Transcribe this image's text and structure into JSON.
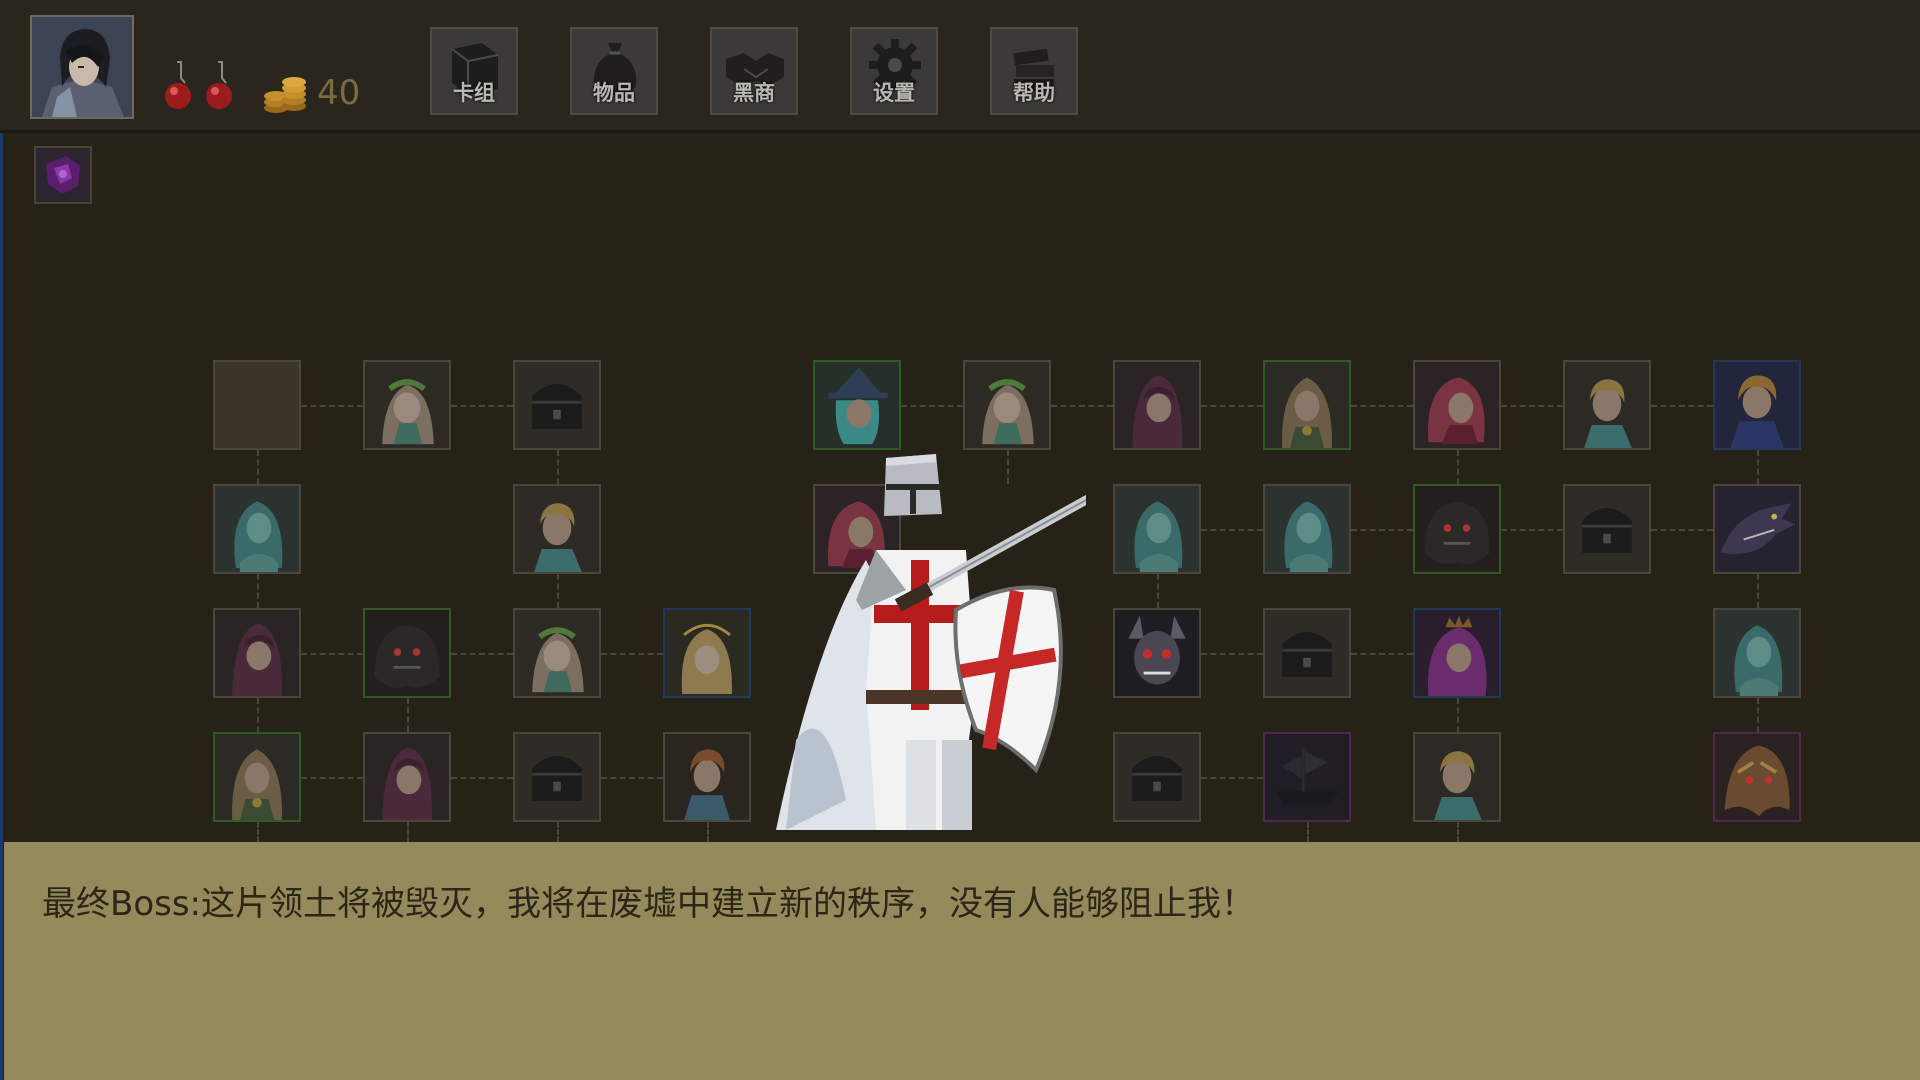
{
  "hud": {
    "avatar_icon": "player-portrait-icon",
    "potions": [
      "red-potion-icon",
      "red-potion-icon"
    ],
    "gold_icon": "gold-coins-icon",
    "gold": "40"
  },
  "menu": [
    {
      "label": "卡组",
      "icon": "book-icon"
    },
    {
      "label": "物品",
      "icon": "bag-icon"
    },
    {
      "label": "黑商",
      "icon": "handshake-icon"
    },
    {
      "label": "设置",
      "icon": "gear-icon"
    },
    {
      "label": "帮助",
      "icon": "books-icon"
    }
  ],
  "relic_icon": "purple-relic-icon",
  "map_nodes": [
    {
      "name": "node-empty",
      "icon": "empty-node",
      "border": "normal"
    },
    {
      "name": "node-elf-girl",
      "icon": "elf-girl-icon",
      "border": "normal"
    },
    {
      "name": "node-chest",
      "icon": "chest-icon",
      "border": "normal"
    },
    {
      "name": "node-witch",
      "icon": "witch-icon",
      "border": "green"
    },
    {
      "name": "node-elf-girl",
      "icon": "elf-girl-icon",
      "border": "normal"
    },
    {
      "name": "node-hooded-figure",
      "icon": "hooded-figure-icon",
      "border": "normal"
    },
    {
      "name": "node-priestess",
      "icon": "priestess-icon",
      "border": "green"
    },
    {
      "name": "node-pink-hair-girl",
      "icon": "pink-hair-girl-icon",
      "border": "normal"
    },
    {
      "name": "node-blond-boy",
      "icon": "blond-boy-icon",
      "border": "normal"
    },
    {
      "name": "node-hero-boy",
      "icon": "hero-boy-icon",
      "border": "blue"
    },
    {
      "name": "node-ghost-maiden",
      "icon": "ghost-maiden-icon",
      "border": "normal"
    },
    {
      "name": "node-blond-boy",
      "icon": "blond-boy-icon",
      "border": "normal"
    },
    {
      "name": "node-pink-hair-girl",
      "icon": "pink-hair-girl-icon",
      "border": "normal"
    },
    {
      "name": "node-ghost-maiden",
      "icon": "ghost-maiden-icon",
      "border": "normal"
    },
    {
      "name": "node-ghost-maiden",
      "icon": "ghost-maiden-icon",
      "border": "normal"
    },
    {
      "name": "node-dark-beast",
      "icon": "dark-beast-icon",
      "border": "green"
    },
    {
      "name": "node-chest",
      "icon": "chest-icon",
      "border": "normal"
    },
    {
      "name": "node-dragon",
      "icon": "dragon-icon",
      "border": "normal"
    },
    {
      "name": "node-hooded-figure",
      "icon": "hooded-figure-icon",
      "border": "normal"
    },
    {
      "name": "node-dark-beast",
      "icon": "dark-beast-icon",
      "border": "green"
    },
    {
      "name": "node-elf-girl",
      "icon": "elf-girl-icon",
      "border": "normal"
    },
    {
      "name": "node-angel",
      "icon": "angel-icon",
      "border": "blue"
    },
    {
      "name": "node-demon",
      "icon": "demon-icon",
      "border": "normal"
    },
    {
      "name": "node-chest",
      "icon": "chest-icon",
      "border": "normal"
    },
    {
      "name": "node-queen",
      "icon": "queen-icon",
      "border": "blue"
    },
    {
      "name": "node-ghost-maiden",
      "icon": "ghost-maiden-icon",
      "border": "normal"
    },
    {
      "name": "node-priestess",
      "icon": "priestess-icon",
      "border": "green"
    },
    {
      "name": "node-hooded-figure",
      "icon": "hooded-figure-icon",
      "border": "normal"
    },
    {
      "name": "node-chest",
      "icon": "chest-icon",
      "border": "normal"
    },
    {
      "name": "node-red-hair-boy",
      "icon": "red-hair-boy-icon",
      "border": "normal"
    },
    {
      "name": "node-chest",
      "icon": "chest-icon",
      "border": "normal"
    },
    {
      "name": "node-ghost-ship",
      "icon": "ghost-ship-icon",
      "border": "purple"
    },
    {
      "name": "node-blond-boy",
      "icon": "blond-boy-icon",
      "border": "normal"
    },
    {
      "name": "node-beast-boss",
      "icon": "beast-boss-icon",
      "border": "purple"
    }
  ],
  "boss_portrait": "crusader-knight-icon",
  "dialog": {
    "text": "最终Boss:这片领土将被毁灭，我将在废墟中建立新的秩序，没有人能够阻止我！"
  }
}
